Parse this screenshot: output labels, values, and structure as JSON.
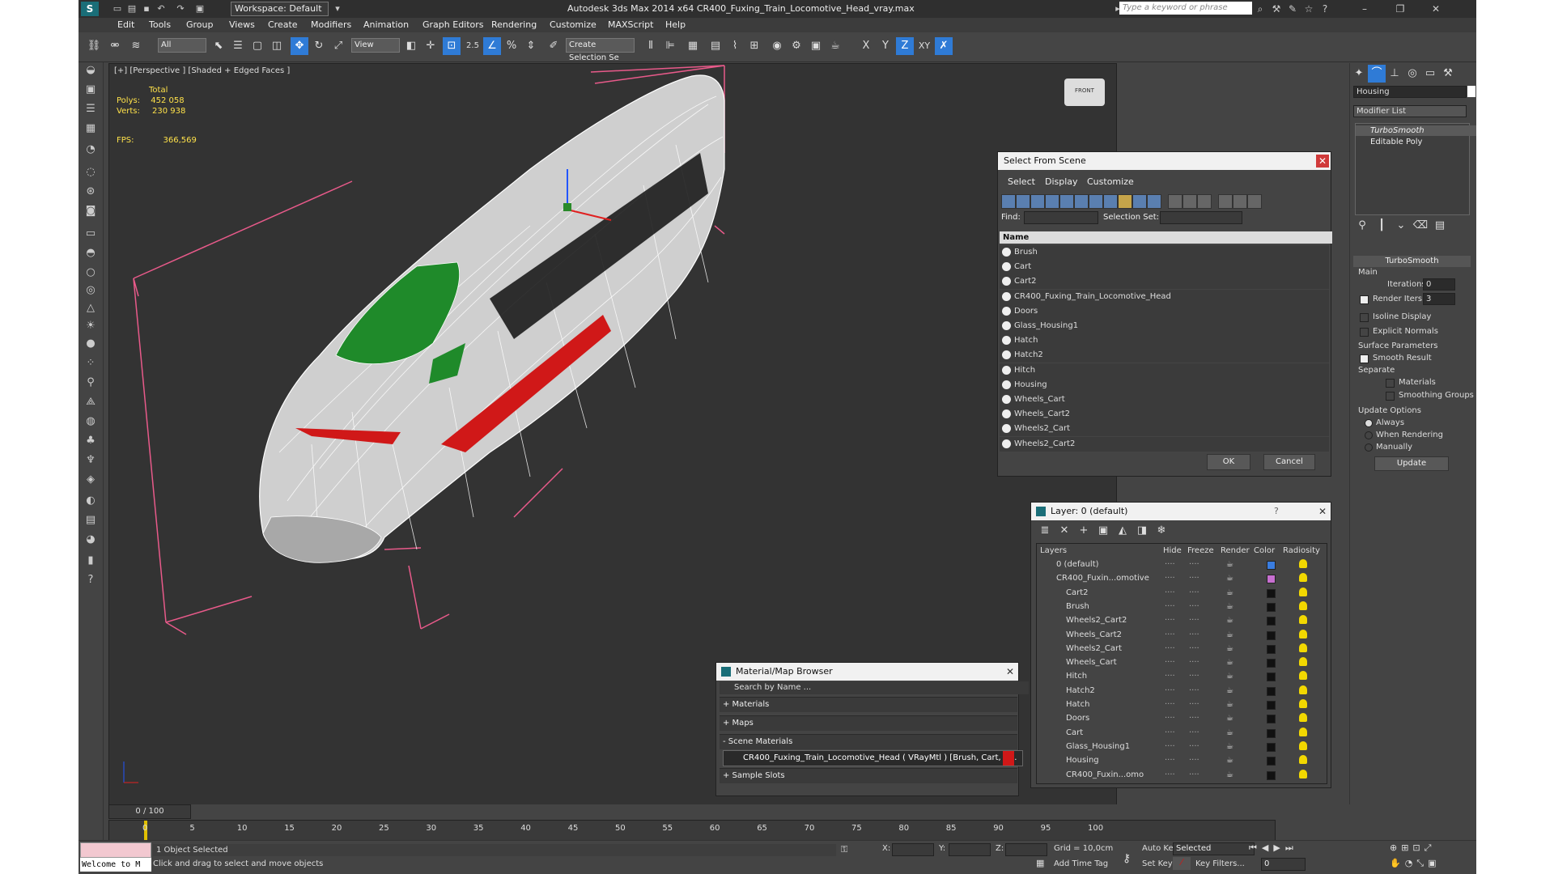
{
  "window": {
    "title": "Autodesk 3ds Max  2014 x64     CR400_Fuxing_Train_Locomotive_Head_vray.max",
    "workspace": "Workspace: Default",
    "search_placeholder": "Type a keyword or phrase"
  },
  "menu": [
    "Edit",
    "Tools",
    "Group",
    "Views",
    "Create",
    "Modifiers",
    "Animation",
    "Graph Editors",
    "Rendering",
    "Customize",
    "MAXScript",
    "Help"
  ],
  "toolbar": {
    "filter": "All",
    "refcoord": "View",
    "snap_value": "2.5",
    "named_selection": "Create Selection Se",
    "axis_x": "X",
    "axis_y": "Y",
    "axis_z": "Z",
    "axis_xy": "XY"
  },
  "viewport": {
    "label": "[+] [Perspective ] [Shaded + Edged Faces ]",
    "stats": {
      "header": "Total",
      "polys_label": "Polys:",
      "polys": "452 058",
      "verts_label": "Verts:",
      "verts": "230 938",
      "fps_label": "FPS:",
      "fps": "366,569"
    },
    "cube_label": "FRONT",
    "colors": {
      "body": "#d6d6d6",
      "wire": "#ffffff",
      "glass": "#1f8a2a",
      "stripe": "#d01818",
      "bbox": "#e85a8a",
      "bg": "#333333"
    }
  },
  "select_from_scene": {
    "title": "Select From Scene",
    "menu": [
      "Select",
      "Display",
      "Customize"
    ],
    "find_label": "Find:",
    "selection_set_label": "Selection Set:",
    "column_name": "Name",
    "items": [
      "Brush",
      "Cart",
      "Cart2",
      "CR400_Fuxing_Train_Locomotive_Head",
      "Doors",
      "Glass_Housing1",
      "Hatch",
      "Hatch2",
      "Hitch",
      "Housing",
      "Wheels_Cart",
      "Wheels_Cart2",
      "Wheels2_Cart",
      "Wheels2_Cart2"
    ],
    "ok": "OK",
    "cancel": "Cancel"
  },
  "layer_dialog": {
    "title": "Layer: 0 (default)",
    "help": "?",
    "columns": [
      "Layers",
      "Hide",
      "Freeze",
      "Render",
      "Color",
      "Radiosity"
    ],
    "rows": [
      {
        "name": "0 (default)",
        "indent": 0
      },
      {
        "name": "CR400_Fuxin...omotive",
        "indent": 0
      },
      {
        "name": "Cart2",
        "indent": 1
      },
      {
        "name": "Brush",
        "indent": 1
      },
      {
        "name": "Wheels2_Cart2",
        "indent": 1
      },
      {
        "name": "Wheels_Cart2",
        "indent": 1
      },
      {
        "name": "Wheels2_Cart",
        "indent": 1
      },
      {
        "name": "Wheels_Cart",
        "indent": 1
      },
      {
        "name": "Hitch",
        "indent": 1
      },
      {
        "name": "Hatch2",
        "indent": 1
      },
      {
        "name": "Hatch",
        "indent": 1
      },
      {
        "name": "Doors",
        "indent": 1
      },
      {
        "name": "Cart",
        "indent": 1
      },
      {
        "name": "Glass_Housing1",
        "indent": 1
      },
      {
        "name": "Housing",
        "indent": 1
      },
      {
        "name": "CR400_Fuxin...omo",
        "indent": 1
      }
    ],
    "row_colors": [
      "#3a7de0",
      "#c76fd0"
    ]
  },
  "material_browser": {
    "title": "Material/Map Browser",
    "search_placeholder": "Search by Name ...",
    "sections": [
      "+ Materials",
      "+ Maps",
      "- Scene Materials",
      "+ Sample Slots"
    ],
    "scene_material": "CR400_Fuxing_Train_Locomotive_Head  ( VRayMtl )  [Brush, Cart, C..."
  },
  "command_panel": {
    "object_name": "Housing",
    "modifier_list": "Modifier List",
    "stack": [
      "TurboSmooth",
      "Editable Poly"
    ],
    "rollout_title": "TurboSmooth",
    "main_label": "Main",
    "iterations_label": "Iterations:",
    "iterations": "0",
    "render_iters_label": "Render Iters:",
    "render_iters": "3",
    "isoline": "Isoline Display",
    "explicit": "Explicit Normals",
    "surface_params": "Surface Parameters",
    "smooth_result": "Smooth Result",
    "separate": "Separate",
    "materials": "Materials",
    "smoothing_groups": "Smoothing Groups",
    "update_options": "Update Options",
    "always": "Always",
    "when_rendering": "When Rendering",
    "manually": "Manually",
    "update_btn": "Update"
  },
  "timeline": {
    "frame": "0 / 100",
    "ticks": [
      "0",
      "5",
      "10",
      "15",
      "20",
      "25",
      "30",
      "35",
      "40",
      "45",
      "50",
      "55",
      "60",
      "65",
      "70",
      "75",
      "80",
      "85",
      "90",
      "95",
      "100"
    ]
  },
  "status": {
    "maxscript": "Welcome to M",
    "selected": "1 Object Selected",
    "prompt": "Click and drag to select and move objects",
    "x_label": "X:",
    "y_label": "Y:",
    "z_label": "Z:",
    "grid": "Grid = 10,0cm",
    "add_time_tag": "Add Time Tag",
    "auto_key": "Auto Key",
    "set_key": "Set Key",
    "selected_dropdown": "Selected",
    "key_filters": "Key Filters...",
    "frame_value": "0"
  }
}
